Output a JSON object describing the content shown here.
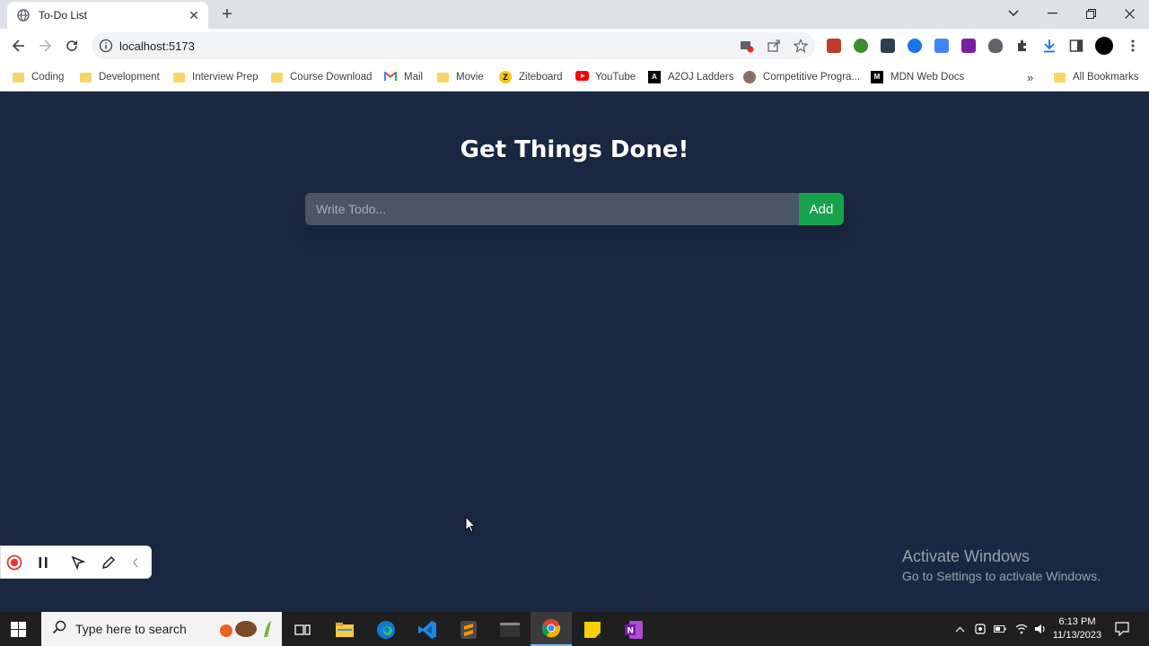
{
  "browser": {
    "tab_title": "To-Do List",
    "url": "localhost:5173"
  },
  "bookmarks": [
    {
      "label": "Coding",
      "icon": "folder-icon"
    },
    {
      "label": "Development",
      "icon": "folder-icon"
    },
    {
      "label": "Interview Prep",
      "icon": "folder-icon"
    },
    {
      "label": "Course Download",
      "icon": "folder-icon"
    },
    {
      "label": "Mail",
      "icon": "gmail-icon"
    },
    {
      "label": "Movie",
      "icon": "folder-icon"
    },
    {
      "label": "Ziteboard",
      "icon": "ziteboard-icon"
    },
    {
      "label": "YouTube",
      "icon": "youtube-icon"
    },
    {
      "label": "A2OJ Ladders",
      "icon": "a2oj-icon"
    },
    {
      "label": "Competitive Progra...",
      "icon": "competitive-programming-icon"
    },
    {
      "label": "MDN Web Docs",
      "icon": "mdn-icon"
    },
    {
      "label": "All Bookmarks",
      "icon": "folder-icon"
    }
  ],
  "app": {
    "heading": "Get Things Done!",
    "input_placeholder": "Write Todo...",
    "input_value": "",
    "add_label": "Add"
  },
  "watermark": {
    "line1": "Activate Windows",
    "line2": "Go to Settings to activate Windows."
  },
  "taskbar": {
    "search_placeholder": "Type here to search",
    "time": "6:13 PM",
    "date": "11/13/2023"
  },
  "colors": {
    "page_background": "#1a2741",
    "input_background": "#4a5568",
    "add_button": "#16a34a"
  }
}
